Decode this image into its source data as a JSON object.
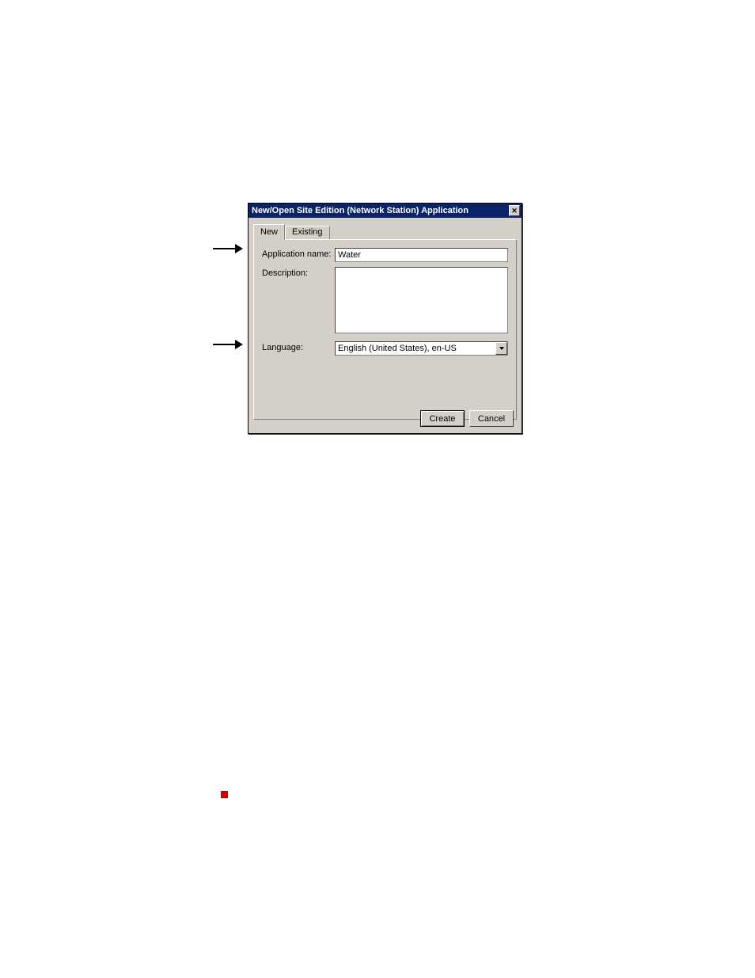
{
  "dialog": {
    "title": "New/Open Site Edition (Network Station) Application",
    "close_label": "X"
  },
  "tabs": {
    "new_label": "New",
    "existing_label": "Existing"
  },
  "form": {
    "app_name_label": "Application name:",
    "app_name_value": "Water",
    "description_label": "Description:",
    "description_value": "",
    "language_label": "Language:",
    "language_value": "English (United States), en-US"
  },
  "buttons": {
    "create_label": "Create",
    "cancel_label": "Cancel"
  }
}
